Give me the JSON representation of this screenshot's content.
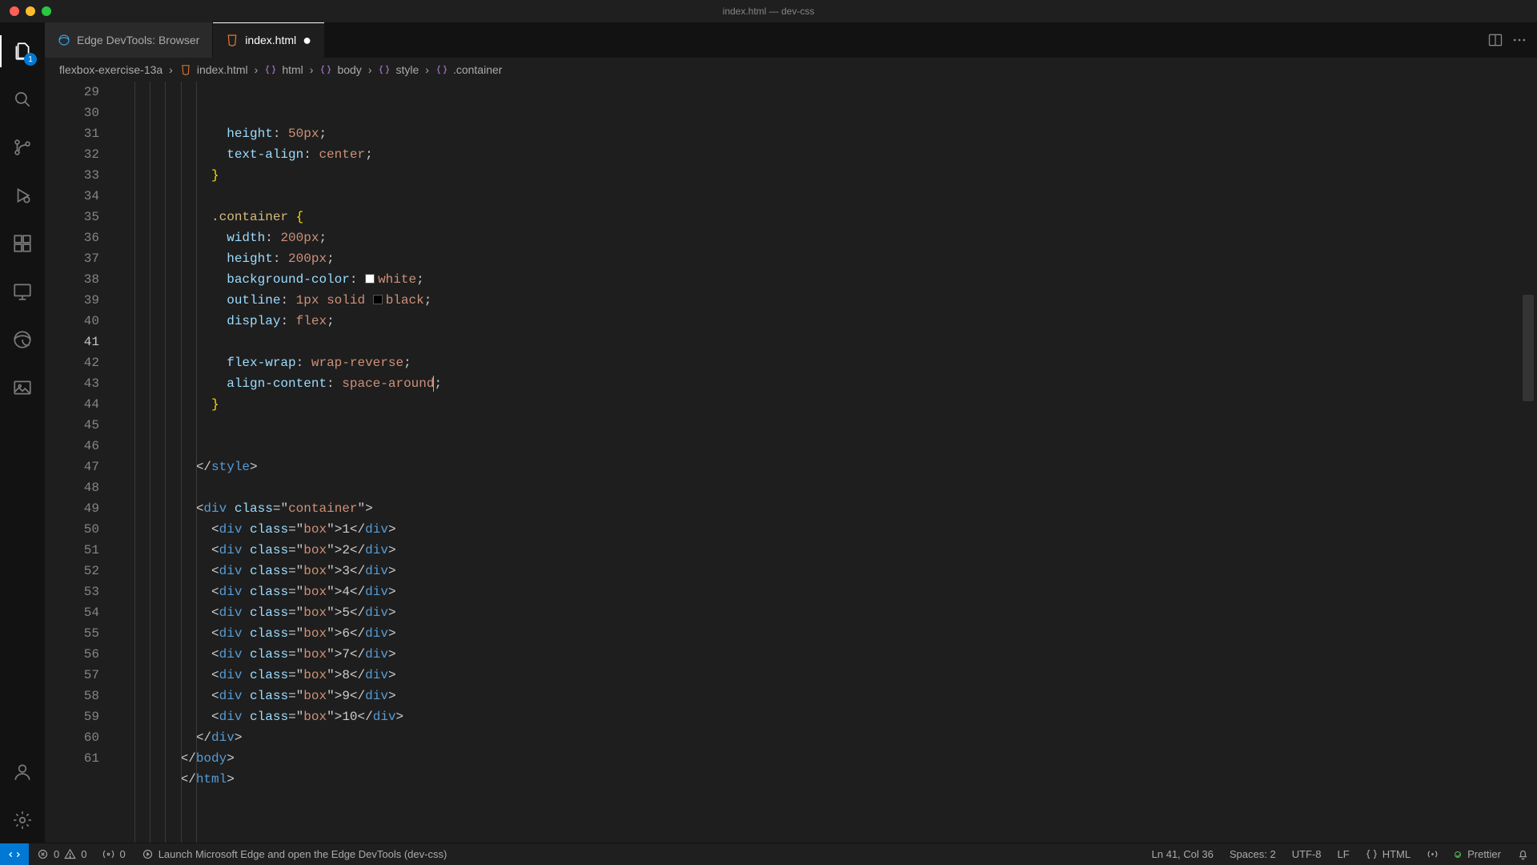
{
  "window": {
    "title": "index.html — dev-css"
  },
  "activity": {
    "explorer_badge": "1"
  },
  "tabs": [
    {
      "label": "Edge DevTools: Browser",
      "icon": "edge",
      "active": false,
      "dirty": false
    },
    {
      "label": "index.html",
      "icon": "html",
      "active": true,
      "dirty": true
    }
  ],
  "breadcrumbs": [
    {
      "label": "flexbox-exercise-13a",
      "icon": null
    },
    {
      "label": "index.html",
      "icon": "html"
    },
    {
      "label": "html",
      "icon": "symbol"
    },
    {
      "label": "body",
      "icon": "symbol"
    },
    {
      "label": "style",
      "icon": "symbol"
    },
    {
      "label": ".container",
      "icon": "symbol"
    }
  ],
  "editor": {
    "first_line_no": 29,
    "current_line_no": 41,
    "indent_unit": "  ",
    "lines": [
      {
        "n": 29,
        "kind": "css-decl",
        "indent": 6,
        "prop": "height",
        "val": "50px"
      },
      {
        "n": 30,
        "kind": "css-decl",
        "indent": 6,
        "prop": "text-align",
        "val": "center"
      },
      {
        "n": 31,
        "kind": "css-close",
        "indent": 5
      },
      {
        "n": 32,
        "kind": "blank"
      },
      {
        "n": 33,
        "kind": "css-open",
        "indent": 5,
        "selector": ".container"
      },
      {
        "n": 34,
        "kind": "css-decl",
        "indent": 6,
        "prop": "width",
        "val": "200px"
      },
      {
        "n": 35,
        "kind": "css-decl",
        "indent": 6,
        "prop": "height",
        "val": "200px"
      },
      {
        "n": 36,
        "kind": "css-decl",
        "indent": 6,
        "prop": "background-color",
        "val": "white",
        "swatch": "#ffffff"
      },
      {
        "n": 37,
        "kind": "css-decl",
        "indent": 6,
        "prop": "outline",
        "val": "1px solid black",
        "parts": [
          {
            "t": "1px",
            "c": "val"
          },
          {
            "t": " ",
            "c": "punc"
          },
          {
            "t": "solid",
            "c": "val"
          },
          {
            "t": " ",
            "c": "punc"
          },
          {
            "swatch": "#000000"
          },
          {
            "t": "black",
            "c": "val"
          }
        ]
      },
      {
        "n": 38,
        "kind": "css-decl",
        "indent": 6,
        "prop": "display",
        "val": "flex"
      },
      {
        "n": 39,
        "kind": "blank"
      },
      {
        "n": 40,
        "kind": "css-decl",
        "indent": 6,
        "prop": "flex-wrap",
        "val": "wrap-reverse"
      },
      {
        "n": 41,
        "kind": "css-decl",
        "indent": 6,
        "prop": "align-content",
        "val": "space-around",
        "cursor_after_val": true
      },
      {
        "n": 42,
        "kind": "css-close",
        "indent": 5
      },
      {
        "n": 43,
        "kind": "blank"
      },
      {
        "n": 44,
        "kind": "blank"
      },
      {
        "n": 45,
        "kind": "html-close",
        "indent": 4,
        "tag": "style"
      },
      {
        "n": 46,
        "kind": "blank"
      },
      {
        "n": 47,
        "kind": "html-open",
        "indent": 4,
        "tag": "div",
        "attrs": [
          {
            "name": "class",
            "value": "container"
          }
        ]
      },
      {
        "n": 48,
        "kind": "html-leaf",
        "indent": 5,
        "tag": "div",
        "attrs": [
          {
            "name": "class",
            "value": "box"
          }
        ],
        "text": "1"
      },
      {
        "n": 49,
        "kind": "html-leaf",
        "indent": 5,
        "tag": "div",
        "attrs": [
          {
            "name": "class",
            "value": "box"
          }
        ],
        "text": "2"
      },
      {
        "n": 50,
        "kind": "html-leaf",
        "indent": 5,
        "tag": "div",
        "attrs": [
          {
            "name": "class",
            "value": "box"
          }
        ],
        "text": "3"
      },
      {
        "n": 51,
        "kind": "html-leaf",
        "indent": 5,
        "tag": "div",
        "attrs": [
          {
            "name": "class",
            "value": "box"
          }
        ],
        "text": "4"
      },
      {
        "n": 52,
        "kind": "html-leaf",
        "indent": 5,
        "tag": "div",
        "attrs": [
          {
            "name": "class",
            "value": "box"
          }
        ],
        "text": "5"
      },
      {
        "n": 53,
        "kind": "html-leaf",
        "indent": 5,
        "tag": "div",
        "attrs": [
          {
            "name": "class",
            "value": "box"
          }
        ],
        "text": "6"
      },
      {
        "n": 54,
        "kind": "html-leaf",
        "indent": 5,
        "tag": "div",
        "attrs": [
          {
            "name": "class",
            "value": "box"
          }
        ],
        "text": "7"
      },
      {
        "n": 55,
        "kind": "html-leaf",
        "indent": 5,
        "tag": "div",
        "attrs": [
          {
            "name": "class",
            "value": "box"
          }
        ],
        "text": "8"
      },
      {
        "n": 56,
        "kind": "html-leaf",
        "indent": 5,
        "tag": "div",
        "attrs": [
          {
            "name": "class",
            "value": "box"
          }
        ],
        "text": "9"
      },
      {
        "n": 57,
        "kind": "html-leaf",
        "indent": 5,
        "tag": "div",
        "attrs": [
          {
            "name": "class",
            "value": "box"
          }
        ],
        "text": "10"
      },
      {
        "n": 58,
        "kind": "html-close",
        "indent": 4,
        "tag": "div"
      },
      {
        "n": 59,
        "kind": "html-close",
        "indent": 3,
        "tag": "body"
      },
      {
        "n": 60,
        "kind": "html-close",
        "indent": 3,
        "tag": "html"
      },
      {
        "n": 61,
        "kind": "blank"
      }
    ]
  },
  "status": {
    "errors": "0",
    "warnings": "0",
    "ports": "0",
    "launch": "Launch Microsoft Edge and open the Edge DevTools (dev-css)",
    "cursor": "Ln 41, Col 36",
    "spaces": "Spaces: 2",
    "encoding": "UTF-8",
    "eol": "LF",
    "language": "HTML",
    "prettier": "Prettier"
  }
}
